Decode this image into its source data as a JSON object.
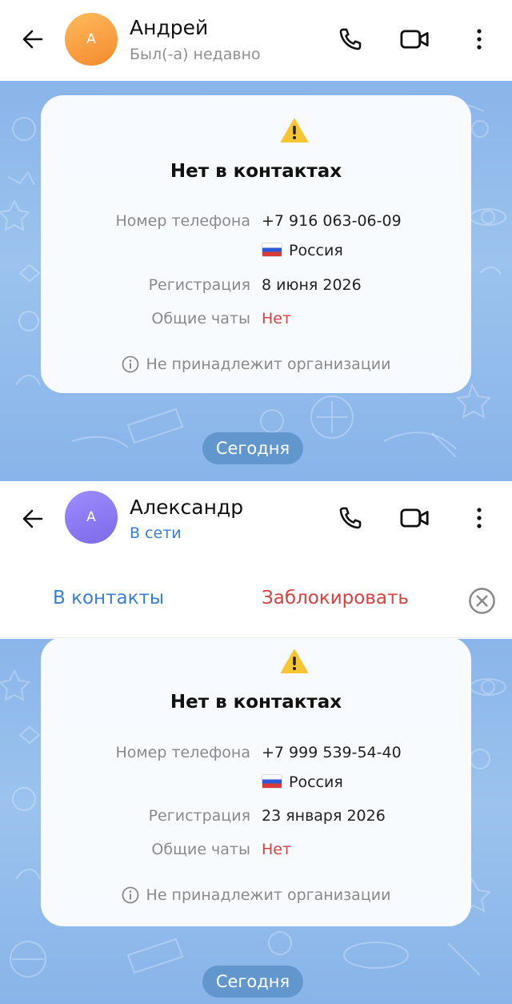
{
  "screen1": {
    "contact": {
      "avatar_letter": "A",
      "name": "Андрей",
      "status": "Был(-а) недавно"
    },
    "card": {
      "title": "Нет в контактах",
      "phone_label": "Номер телефона",
      "phone_value": "+7 916 063-06-09",
      "country": "Россия",
      "reg_label": "Регистрация",
      "reg_value": "8 июня 2026",
      "chats_label": "Общие чаты",
      "chats_value": "Нет",
      "org_text": "Не принадлежит организации"
    },
    "date_pill": "Сегодня"
  },
  "screen2": {
    "contact": {
      "avatar_letter": "A",
      "name": "Александр",
      "status": "В сети"
    },
    "actions": {
      "add_contact": "В контакты",
      "block": "Заблокировать"
    },
    "card": {
      "title": "Нет в контактах",
      "phone_label": "Номер телефона",
      "phone_value": "+7 999 539-54-40",
      "country": "Россия",
      "reg_label": "Регистрация",
      "reg_value": "23 января 2026",
      "chats_label": "Общие чаты",
      "chats_value": "Нет",
      "org_text": "Не принадлежит организации"
    },
    "date_pill": "Сегодня"
  },
  "icons": [
    "back-arrow-icon",
    "phone-icon",
    "video-icon",
    "more-vertical-icon",
    "warning-icon",
    "info-icon",
    "russia-flag-icon",
    "close-circle-icon"
  ],
  "colors": {
    "accent_blue": "#3a7fd6",
    "danger_red": "#d94141",
    "status_grey": "#8f8f8f",
    "warning_yellow": "#f7c531"
  }
}
